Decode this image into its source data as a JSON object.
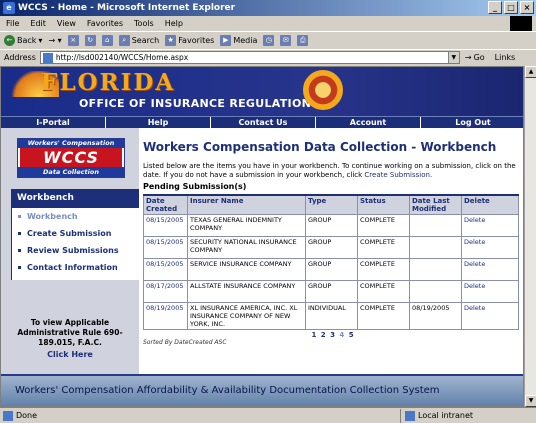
{
  "window": {
    "title": "WCCS - Home - Microsoft Internet Explorer"
  },
  "menu": [
    "File",
    "Edit",
    "View",
    "Favorites",
    "Tools",
    "Help"
  ],
  "toolbar": {
    "back": "Back",
    "search": "Search",
    "favorites": "Favorites",
    "media": "Media"
  },
  "address": {
    "label": "Address",
    "url": "http://lsd002140/WCCS/Home.aspx",
    "go": "Go",
    "links": "Links"
  },
  "banner": {
    "state": "FLORIDA",
    "office": "OFFICE OF INSURANCE REGULATION"
  },
  "nav": [
    "I-Portal",
    "Help",
    "Contact Us",
    "Account",
    "Log Out"
  ],
  "logo": {
    "top": "Workers' Compensation",
    "mid": "WCCS",
    "bottom": "Data Collection"
  },
  "sidebar": {
    "heading": "Workbench",
    "items": [
      "Workbench",
      "Create Submission",
      "Review Submissions",
      "Contact Information"
    ],
    "rules_text": "To view Applicable Administrative Rule 690-189.015, F.A.C.",
    "click_here": "Click Here"
  },
  "main": {
    "title": "Workers Compensation Data Collection - Workbench",
    "intro": "Listed below are the items you have in your workbench. To continue working on a submission, click on the date. If you do not have a submission in your workbench, click",
    "intro_link": "Create Submission.",
    "subtitle": "Pending Submission(s)",
    "columns": [
      "Date Created",
      "Insurer Name",
      "Type",
      "Status",
      "Date Last Modified",
      "Delete"
    ],
    "rows": [
      [
        "08/15/2005",
        "TEXAS GENERAL INDEMNITY COMPANY",
        "GROUP",
        "COMPLETE",
        "",
        "Delete"
      ],
      [
        "08/15/2005",
        "SECURITY NATIONAL INSURANCE COMPANY",
        "GROUP",
        "COMPLETE",
        "",
        "Delete"
      ],
      [
        "08/15/2005",
        "SERVICE INSURANCE COMPANY",
        "GROUP",
        "COMPLETE",
        "",
        "Delete"
      ],
      [
        "08/17/2005",
        "ALLSTATE INSURANCE COMPANY",
        "GROUP",
        "COMPLETE",
        "",
        "Delete"
      ],
      [
        "08/19/2005",
        "XL INSURANCE AMERICA, INC. XL INSURANCE COMPANY OF NEW YORK, INC.",
        "INDIVIDUAL",
        "COMPLETE",
        "08/19/2005",
        "Delete"
      ]
    ],
    "pager": [
      "1",
      "2",
      "3",
      "4",
      "5"
    ],
    "sorted": "Sorted By DateCreated ASC"
  },
  "footer": "Workers' Compensation Affordability & Availability Documentation Collection System",
  "status": {
    "left": "Done",
    "zone": "Local intranet"
  }
}
